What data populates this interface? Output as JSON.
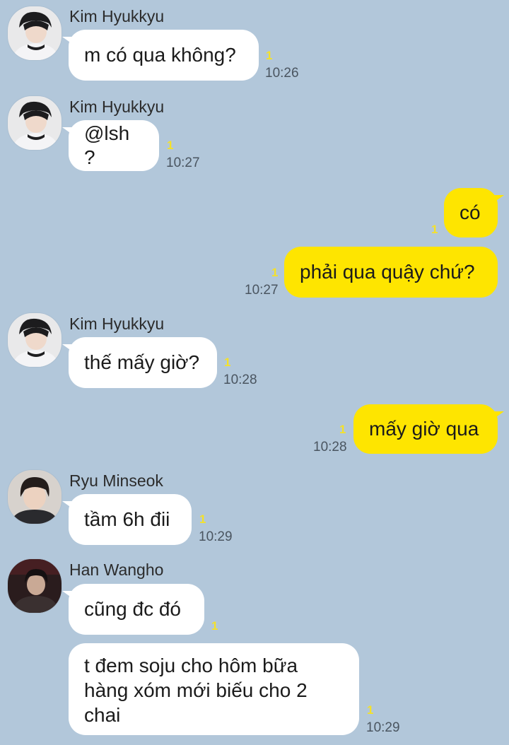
{
  "colors": {
    "background": "#b2c7da",
    "incoming_bubble": "#ffffff",
    "outgoing_bubble": "#fee500",
    "unread": "#f4e12a"
  },
  "messages": [
    {
      "sender": "Kim Hyukkyu",
      "text": "m có qua không?",
      "unread": "1",
      "time": "10:26"
    },
    {
      "sender": "Kim Hyukkyu",
      "text": "@lsh ?",
      "unread": "1",
      "time": "10:27"
    },
    {
      "text": "có",
      "unread": "1"
    },
    {
      "text": "phải qua quậy chứ?",
      "unread": "1",
      "time": "10:27"
    },
    {
      "sender": "Kim Hyukkyu",
      "text": "thế mấy giờ?",
      "unread": "1",
      "time": "10:28"
    },
    {
      "text": "mấy giờ qua",
      "unread": "1",
      "time": "10:28"
    },
    {
      "sender": "Ryu Minseok",
      "text": "tầm 6h đii",
      "unread": "1",
      "time": "10:29"
    },
    {
      "sender": "Han Wangho",
      "text": "cũng đc đó",
      "unread": "1"
    },
    {
      "text_lines": [
        "t đem soju cho hôm bữa",
        "hàng xóm mới biếu cho 2",
        "chai"
      ],
      "unread": "1",
      "time": "10:29"
    }
  ]
}
